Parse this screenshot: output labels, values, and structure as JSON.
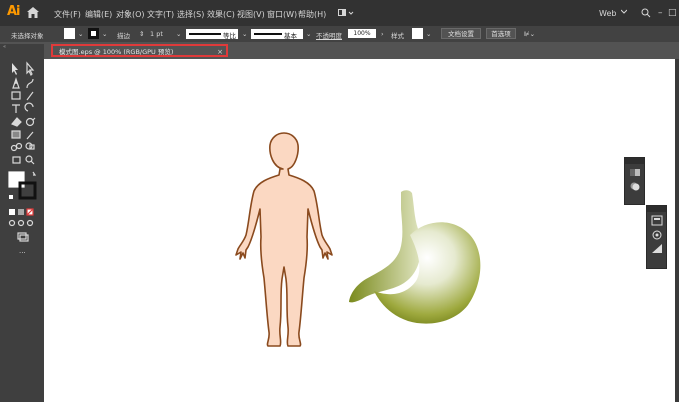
{
  "app": {
    "logo": "Ai"
  },
  "menu": [
    "文件(F)",
    "编辑(E)",
    "对象(O)",
    "文字(T)",
    "选择(S)",
    "效果(C)",
    "视图(V)",
    "窗口(W)",
    "帮助(H)"
  ],
  "workspace": {
    "label": "Web"
  },
  "control_bar": {
    "selection_status": "未选择对象",
    "stroke_label": "描边",
    "stroke_weight": "1 pt",
    "profile_label": "等比",
    "brush_label": "基本",
    "opacity_label": "不透明度",
    "opacity_value": "100%",
    "style_label": "样式",
    "doc_setup_button": "文档设置",
    "preferences_button": "首选项"
  },
  "document_tab": {
    "title": "模式图.eps @ 100% (RGB/GPU 预览)",
    "close": "×"
  },
  "colors": {
    "accent": "#ff9a00",
    "highlight": "#e03a3a",
    "body_fill": "#fbd8c2",
    "body_stroke": "#8a4a1e",
    "stomach": "#7a8a1c"
  },
  "icons": [
    "home-icon",
    "selection-tool-icon",
    "direct-selection-tool-icon",
    "pen-tool-icon",
    "curvature-tool-icon",
    "rectangle-tool-icon",
    "paintbrush-tool-icon",
    "type-tool-icon",
    "rotate-tool-icon",
    "eraser-tool-icon",
    "warp-tool-icon",
    "gradient-tool-icon",
    "eyedropper-tool-icon",
    "blend-tool-icon",
    "shape-builder-tool-icon",
    "artboard-tool-icon",
    "zoom-tool-icon",
    "fill-color-icon",
    "stroke-color-icon",
    "screen-mode-icon"
  ]
}
